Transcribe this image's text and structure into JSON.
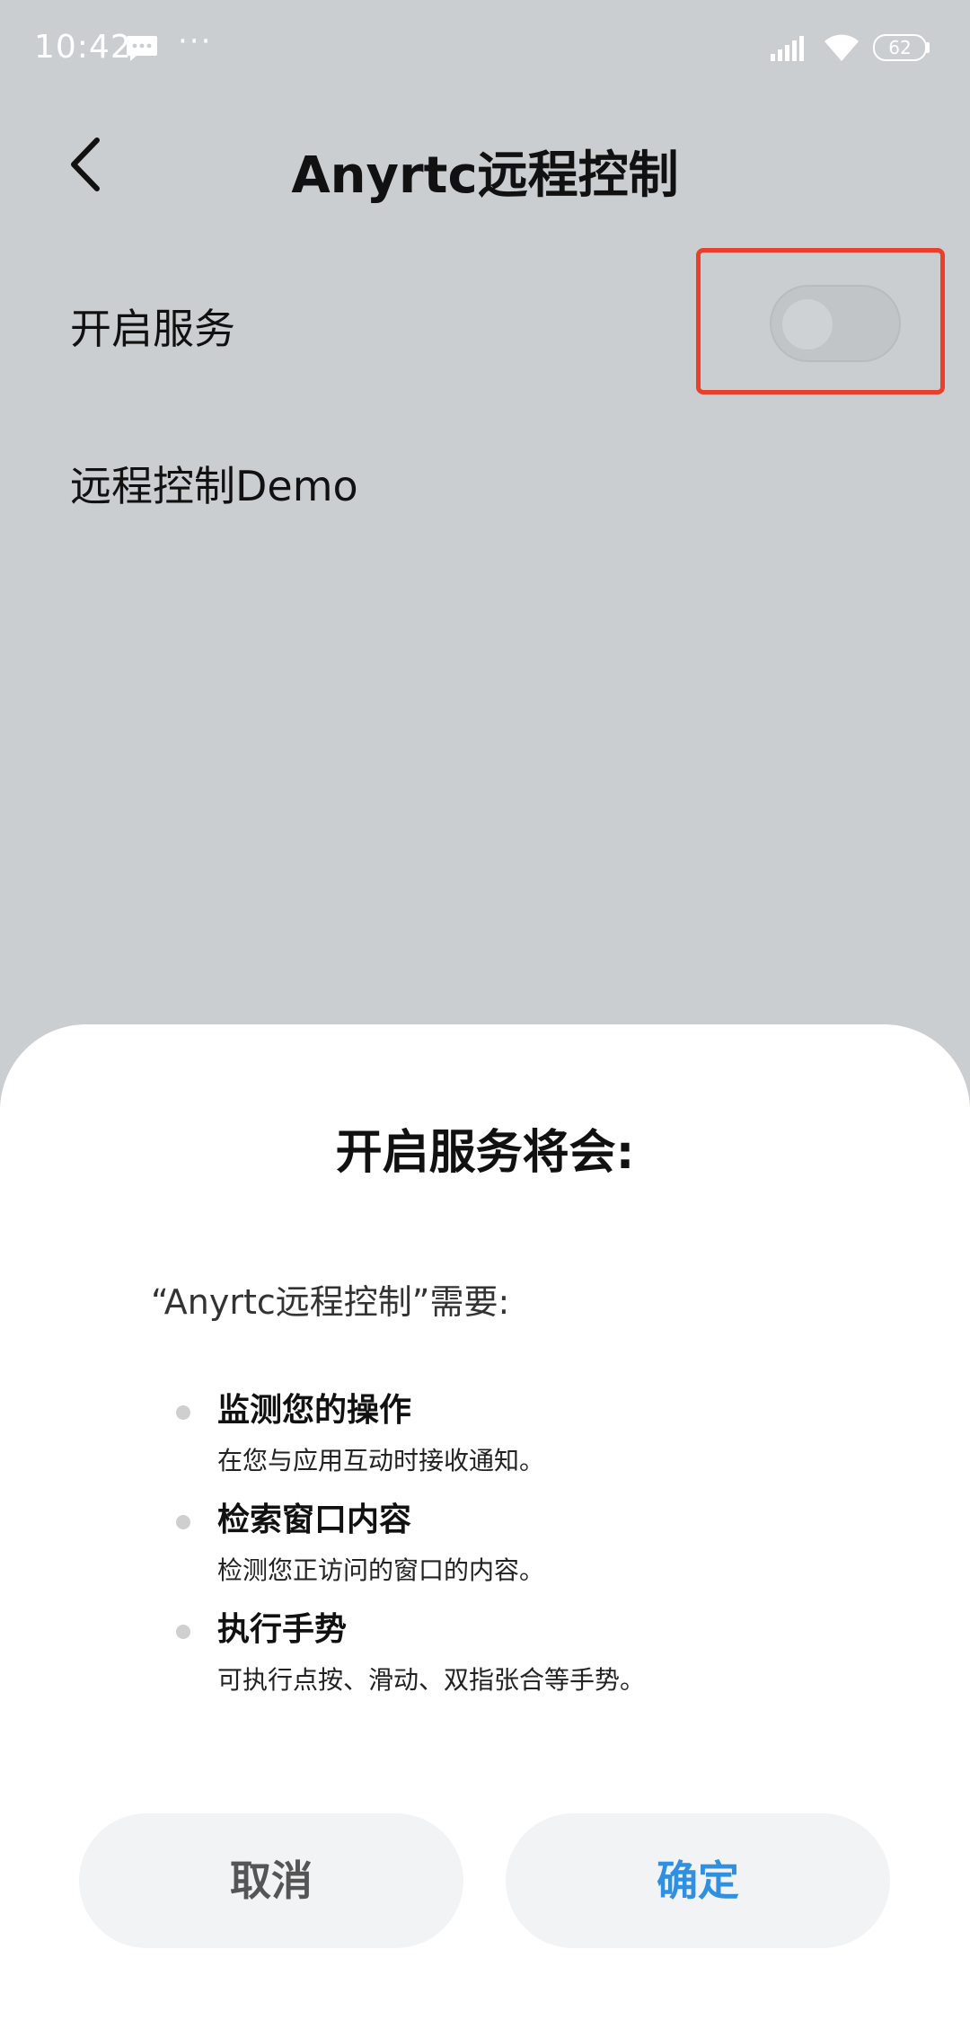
{
  "status_bar": {
    "time": "10:42",
    "battery": "62",
    "more": "···"
  },
  "app_bar": {
    "title": "Anyrtc远程控制"
  },
  "settings": {
    "service_label": "开启服务",
    "service_enabled": false,
    "demo_label": "远程控制Demo"
  },
  "dialog": {
    "title": "开启服务将会:",
    "intro": "“Anyrtc远程控制”需要:",
    "permissions": [
      {
        "title": "监测您的操作",
        "desc": "在您与应用互动时接收通知。"
      },
      {
        "title": "检索窗口内容",
        "desc": "检测您正访问的窗口的内容。"
      },
      {
        "title": "执行手势",
        "desc": "可执行点按、滑动、双指张合等手势。"
      }
    ],
    "cancel_label": "取消",
    "ok_label": "确定"
  },
  "colors": {
    "highlight": "#e8402c",
    "accent": "#2f8fe0",
    "scrim": "#cbced0"
  }
}
